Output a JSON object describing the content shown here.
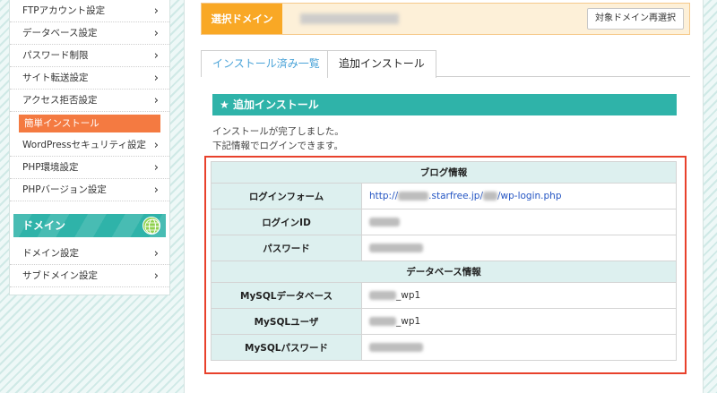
{
  "sidebar": {
    "items": [
      {
        "label": "FTPアカウント設定"
      },
      {
        "label": "データベース設定"
      },
      {
        "label": "パスワード制限"
      },
      {
        "label": "サイト転送設定"
      },
      {
        "label": "アクセス拒否設定"
      },
      {
        "label": "簡単インストール"
      },
      {
        "label": "WordPressセキュリティ設定"
      },
      {
        "label": "PHP環境設定"
      },
      {
        "label": "PHPバージョン設定"
      }
    ],
    "domain_section": {
      "title": "ドメイン",
      "items": [
        {
          "label": "ドメイン設定"
        },
        {
          "label": "サブドメイン設定"
        }
      ]
    },
    "chevron": "›"
  },
  "domain_bar": {
    "label": "選択ドメイン",
    "reselect_button": "対象ドメイン再選択"
  },
  "tabs": [
    {
      "label": "インストール済み一覧",
      "active": false
    },
    {
      "label": "追加インストール",
      "active": true
    }
  ],
  "section": {
    "star": "★",
    "title": "追加インストール",
    "message_line1": "インストールが完了しました。",
    "message_line2": "下記情報でログインできます。"
  },
  "blog_info": {
    "header": "ブログ情報",
    "login_form_label": "ログインフォーム",
    "login_url_prefix": "http://",
    "login_url_middle": ".starfree.jp/",
    "login_url_suffix": "/wp-login.php",
    "login_id_label": "ログインID",
    "password_label": "パスワード"
  },
  "db_info": {
    "header": "データベース情報",
    "db_label": "MySQLデータベース",
    "db_suffix": "_wp1",
    "user_label": "MySQLユーザ",
    "user_suffix": "_wp1",
    "password_label": "MySQLパスワード"
  },
  "colors": {
    "accent_teal": "#2fb3a9",
    "active_orange": "#f47a41",
    "domain_label_orange": "#f9a825",
    "highlight_red": "#e8412c",
    "link_blue": "#2455c3"
  }
}
